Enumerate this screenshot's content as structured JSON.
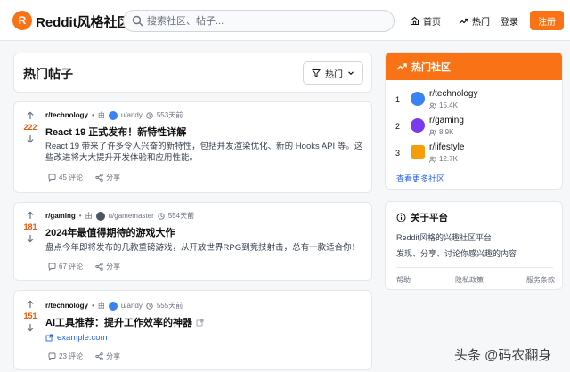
{
  "header": {
    "logo_letter": "R",
    "logo_text": "Reddit风格社区",
    "search_placeholder": "搜索社区、帖子...",
    "nav": {
      "home": "首页",
      "hot": "热门",
      "login": "登录",
      "register": "注册"
    }
  },
  "feed": {
    "title": "热门帖子",
    "sort_label": "热门",
    "posts": [
      {
        "votes": "222",
        "subreddit": "r/technology",
        "by": "由",
        "user": "u/andy",
        "time": "553天前",
        "title": "React 19 正式发布！新特性详解",
        "body": "React 19 带来了许多令人兴奋的新特性，包括并发渲染优化、新的 Hooks API 等。这些改进将大大提升开发体验和应用性能。",
        "comments": "45 评论",
        "share": "分享"
      },
      {
        "votes": "181",
        "subreddit": "r/gaming",
        "by": "由",
        "user": "u/gamemaster",
        "time": "554天前",
        "title": "2024年最值得期待的游戏大作",
        "body": "盘点今年即将发布的几款重磅游戏，从开放世界RPG到竞技射击，总有一款适合你！",
        "comments": "67 评论",
        "share": "分享"
      },
      {
        "votes": "151",
        "subreddit": "r/technology",
        "by": "由",
        "user": "u/andy",
        "time": "555天前",
        "title": "AI工具推荐：提升工作效率的神器",
        "link": "example.com",
        "comments": "23 评论",
        "share": "分享"
      }
    ]
  },
  "sidebar": {
    "hot_title": "热门社区",
    "communities": [
      {
        "rank": "1",
        "name": "r/technology",
        "members": "15.4K",
        "color": "#3b82f6"
      },
      {
        "rank": "2",
        "name": "r/gaming",
        "members": "8.9K",
        "color": "#7c3aed"
      },
      {
        "rank": "3",
        "name": "r/lifestyle",
        "members": "12.7K",
        "color": "#f59e0b"
      }
    ],
    "see_more": "查看更多社区",
    "about_title": "关于平台",
    "about_desc1": "Reddit风格的兴趣社区平台",
    "about_desc2": "发现、分享、讨论你感兴趣的内容",
    "links": {
      "help": "帮助",
      "privacy": "隐私政策",
      "terms": "服务条款"
    }
  },
  "watermark": "头条 @码农翻身",
  "colors": {
    "accent": "#f97316",
    "link": "#2563eb"
  }
}
